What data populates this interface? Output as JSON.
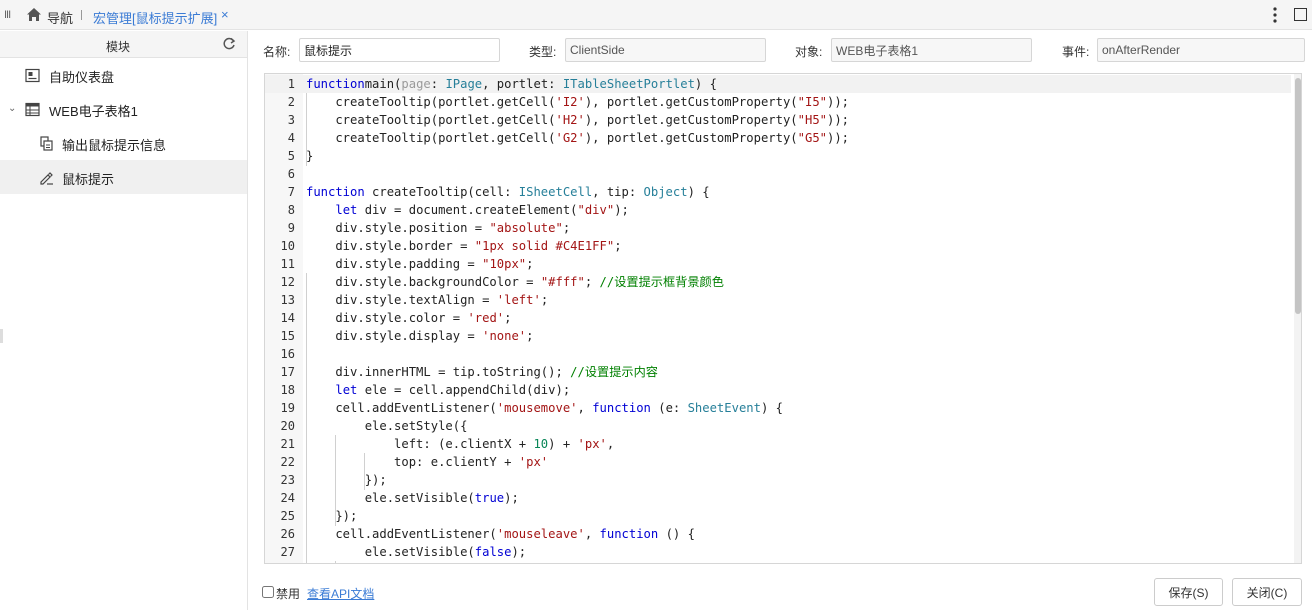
{
  "tabbar": {
    "nav_label": "导航",
    "active_tab_label": "宏管理[鼠标提示扩展]",
    "close_glyph": "×"
  },
  "sidebar": {
    "title": "模块",
    "items": [
      {
        "label": "自助仪表盘",
        "icon": "dashboard-icon"
      },
      {
        "label": "WEB电子表格1",
        "icon": "spreadsheet-icon"
      },
      {
        "label": "输出鼠标提示信息",
        "icon": "macro-icon"
      },
      {
        "label": "鼠标提示",
        "icon": "edit-macro-icon"
      }
    ]
  },
  "form": {
    "name_label": "名称:",
    "name_value": "鼠标提示",
    "type_label": "类型:",
    "type_value": "ClientSide",
    "object_label": "对象:",
    "object_value": "WEB电子表格1",
    "event_label": "事件:",
    "event_value": "onAfterRender"
  },
  "editor": {
    "line_numbers": [
      "1",
      "2",
      "3",
      "4",
      "5",
      "6",
      "7",
      "8",
      "9",
      "10",
      "11",
      "12",
      "13",
      "14",
      "15",
      "16",
      "17",
      "18",
      "19",
      "20",
      "21",
      "22",
      "23",
      "24",
      "25",
      "26",
      "27"
    ],
    "lines": [
      [
        [
          "kw",
          "function"
        ],
        [
          "",
          "main("
        ],
        [
          "pa",
          "page"
        ],
        [
          "",
          ": "
        ],
        [
          "ty",
          "IPage"
        ],
        [
          "",
          ", portlet: "
        ],
        [
          "ty",
          "ITableSheetPortlet"
        ],
        [
          "",
          ") {"
        ]
      ],
      [
        [
          "",
          "    createTooltip(portlet.getCell("
        ],
        [
          "st",
          "'I2'"
        ],
        [
          "",
          "), portlet.getCustomProperty("
        ],
        [
          "st",
          "\"I5\""
        ],
        [
          "",
          "));"
        ]
      ],
      [
        [
          "",
          "    createTooltip(portlet.getCell("
        ],
        [
          "st",
          "'H2'"
        ],
        [
          "",
          "), portlet.getCustomProperty("
        ],
        [
          "st",
          "\"H5\""
        ],
        [
          "",
          "));"
        ]
      ],
      [
        [
          "",
          "    createTooltip(portlet.getCell("
        ],
        [
          "st",
          "'G2'"
        ],
        [
          "",
          "), portlet.getCustomProperty("
        ],
        [
          "st",
          "\"G5\""
        ],
        [
          "",
          "));"
        ]
      ],
      [
        [
          "",
          "}"
        ]
      ],
      [],
      [
        [
          "kw",
          "function"
        ],
        [
          "",
          " createTooltip(cell: "
        ],
        [
          "ty",
          "ISheetCell"
        ],
        [
          "",
          ", tip: "
        ],
        [
          "ty",
          "Object"
        ],
        [
          "",
          ") {"
        ]
      ],
      [
        [
          "",
          "    "
        ],
        [
          "kw",
          "let"
        ],
        [
          "",
          " div = document.createElement("
        ],
        [
          "st",
          "\"div\""
        ],
        [
          "",
          ");"
        ]
      ],
      [
        [
          "",
          "    div.style.position = "
        ],
        [
          "st",
          "\"absolute\""
        ],
        [
          "",
          ";"
        ]
      ],
      [
        [
          "",
          "    div.style.border = "
        ],
        [
          "st",
          "\"1px solid #C4E1FF\""
        ],
        [
          "",
          ";"
        ]
      ],
      [
        [
          "",
          "    div.style.padding = "
        ],
        [
          "st",
          "\"10px\""
        ],
        [
          "",
          ";"
        ]
      ],
      [
        [
          "",
          "    div.style.backgroundColor = "
        ],
        [
          "st",
          "\"#fff\""
        ],
        [
          "",
          "; "
        ],
        [
          "cm",
          "//设置提示框背景颜色"
        ]
      ],
      [
        [
          "",
          "    div.style.textAlign = "
        ],
        [
          "st",
          "'left'"
        ],
        [
          "",
          ";"
        ]
      ],
      [
        [
          "",
          "    div.style.color = "
        ],
        [
          "st",
          "'red'"
        ],
        [
          "",
          ";"
        ]
      ],
      [
        [
          "",
          "    div.style.display = "
        ],
        [
          "st",
          "'none'"
        ],
        [
          "",
          ";"
        ]
      ],
      [],
      [
        [
          "",
          "    div.innerHTML = tip.toString(); "
        ],
        [
          "cm",
          "//设置提示内容"
        ]
      ],
      [
        [
          "",
          "    "
        ],
        [
          "kw",
          "let"
        ],
        [
          "",
          " ele = cell.appendChild(div);"
        ]
      ],
      [
        [
          "",
          "    cell.addEventListener("
        ],
        [
          "st",
          "'mousemove'"
        ],
        [
          "",
          ", "
        ],
        [
          "kw",
          "function"
        ],
        [
          "",
          " (e: "
        ],
        [
          "ty",
          "SheetEvent"
        ],
        [
          "",
          ") {"
        ]
      ],
      [
        [
          "",
          "        ele.setStyle({"
        ]
      ],
      [
        [
          "",
          "            left: (e.clientX + "
        ],
        [
          "nu",
          "10"
        ],
        [
          "",
          ") + "
        ],
        [
          "st",
          "'px'"
        ],
        [
          "",
          ","
        ]
      ],
      [
        [
          "",
          "            top: e.clientY + "
        ],
        [
          "st",
          "'px'"
        ]
      ],
      [
        [
          "",
          "        });"
        ]
      ],
      [
        [
          "",
          "        ele.setVisible("
        ],
        [
          "kw",
          "true"
        ],
        [
          "",
          ");"
        ]
      ],
      [
        [
          "",
          "    });"
        ]
      ],
      [
        [
          "",
          "    cell.addEventListener("
        ],
        [
          "st",
          "'mouseleave'"
        ],
        [
          "",
          ", "
        ],
        [
          "kw",
          "function"
        ],
        [
          "",
          " () {"
        ]
      ],
      [
        [
          "",
          "        ele.setVisible("
        ],
        [
          "kw",
          "false"
        ],
        [
          "",
          ");"
        ]
      ]
    ]
  },
  "footer": {
    "disable_label": "禁用",
    "api_link_label": "查看API文档",
    "save_label": "保存(S)",
    "close_label": "关闭(C)"
  },
  "colors": {
    "accent": "#3a7bd5",
    "keyword": "#0000d4",
    "type": "#267f99",
    "string": "#a31515",
    "comment": "#008000"
  }
}
